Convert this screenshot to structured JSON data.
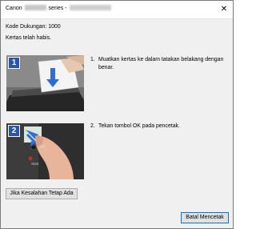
{
  "window": {
    "title_prefix": "Canon",
    "title_suffix": "series -",
    "close_glyph": "✕"
  },
  "message": {
    "support_code": "Kode Dukungan: 1000",
    "paper_out": "Kertas telah habis."
  },
  "steps": [
    {
      "number": "1",
      "index_label": "1.",
      "text_line1": "Muatkan kertas ke dalam tatakan belakang dengan",
      "text_line2": "benar."
    },
    {
      "number": "2",
      "index_label": "2.",
      "text_line1": "Tekan tombol OK pada pencetak."
    }
  ],
  "illustration2": {
    "ok_label": "OK",
    "start_label": "Start"
  },
  "buttons": {
    "persist_label": "Jika Kesalahan Tetap Ada",
    "cancel_label": "Batal Mencetak"
  }
}
